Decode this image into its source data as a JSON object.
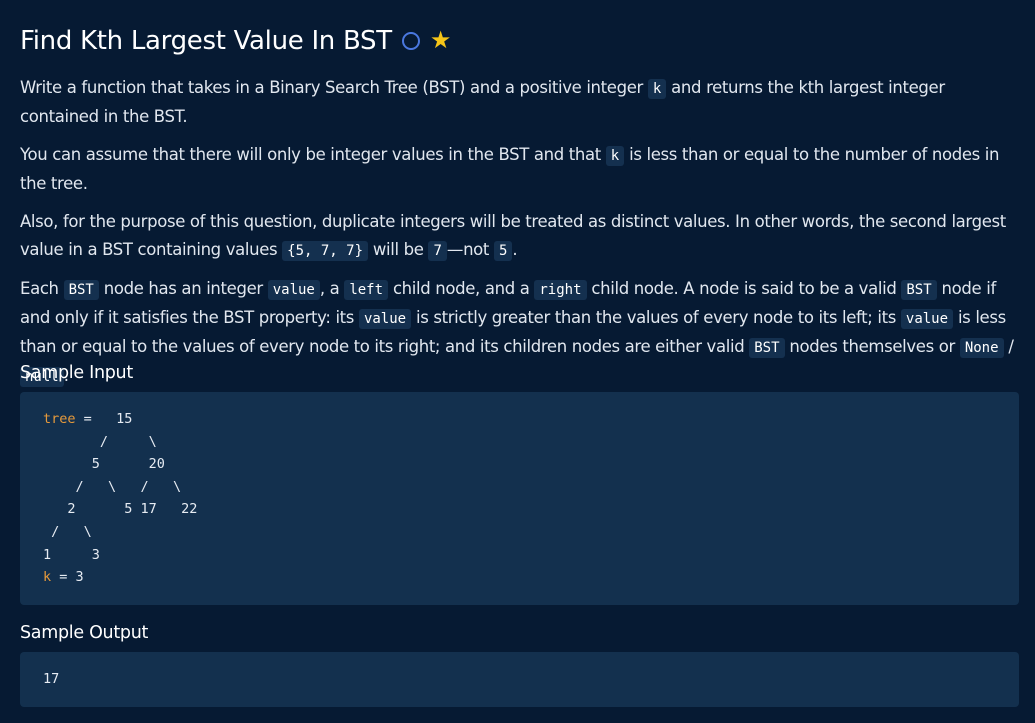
{
  "problem": {
    "title": "Find Kth Largest Value In BST",
    "status_icon": "circle-outline-icon",
    "favorite_icon": "star-icon",
    "accent_color": "#4a78e0",
    "star_color": "#f5c518"
  },
  "description": {
    "p1": {
      "t1": "Write a function that takes in a Binary Search Tree (BST) and a positive integer ",
      "c1": "k",
      "t2": " and returns the kth largest integer contained in the BST."
    },
    "p2": {
      "t1": "You can assume that there will only be integer values in the BST and that ",
      "c1": "k",
      "t2": " is less than or equal to the number of nodes in the tree."
    },
    "p3": {
      "t1": "Also, for the purpose of this question, duplicate integers will be treated as distinct values. In other words, the second largest value in a BST containing values ",
      "c1": "{5, 7, 7}",
      "t2": " will be ",
      "c2": "7",
      "t3": "—not ",
      "c3": "5",
      "t4": "."
    },
    "p4": {
      "t1": "Each ",
      "c1": "BST",
      "t2": " node has an integer ",
      "c2": "value",
      "t3": ", a ",
      "c3": "left",
      "t4": " child node, and a ",
      "c4": "right",
      "t5": " child node. A node is said to be a valid ",
      "c5": "BST",
      "t6": " node if and only if it satisfies the BST property: its ",
      "c6": "value",
      "t7": " is strictly greater than the values of every node to its left; its ",
      "c7": "value",
      "t8": " is less than or equal to the values of every node to its right; and its children nodes are either valid ",
      "c8": "BST",
      "t9": " nodes themselves or ",
      "c9": "None",
      "t10": " / ",
      "c10": "null",
      "t11": "."
    }
  },
  "sample_input": {
    "heading": "Sample Input",
    "tree_var": "tree",
    "tree_eq": " =   15",
    "tree_lines": "       /     \\\n      5      20\n    /   \\   /   \\\n   2      5 17   22\n /   \\\n1     3",
    "k_var": "k",
    "k_rest": " = 3"
  },
  "sample_output": {
    "heading": "Sample Output",
    "value": "17"
  }
}
